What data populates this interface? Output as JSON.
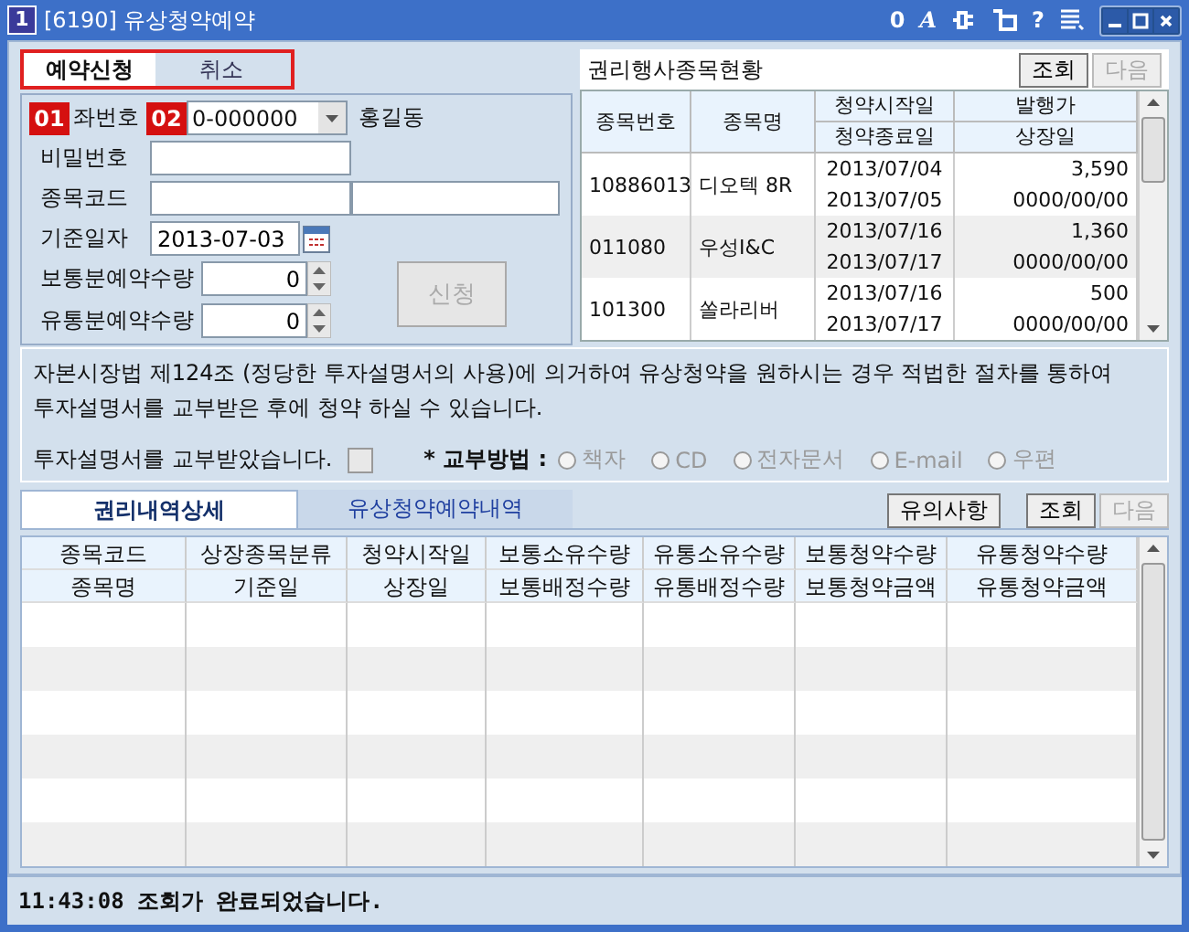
{
  "window": {
    "icon": "1",
    "title": "[6190] 유상청약예약",
    "toolbar": [
      {
        "kind": "text",
        "label": "0"
      },
      {
        "kind": "italic",
        "label": "A"
      },
      {
        "kind": "plug"
      },
      {
        "kind": "corner"
      },
      {
        "kind": "text",
        "label": "?"
      },
      {
        "kind": "list"
      }
    ]
  },
  "markers": [
    {
      "label": "01"
    },
    {
      "label": "02"
    }
  ],
  "top_tabs": [
    {
      "label": "예약신청",
      "selected": true
    },
    {
      "label": "취소",
      "selected": false
    }
  ],
  "form": {
    "account": {
      "label": "좌번호",
      "value": "0-000000",
      "owner": "홍길동"
    },
    "password": {
      "label": "비밀번호"
    },
    "stock_code": {
      "label": "종목코드"
    },
    "base_date": {
      "label": "기준일자",
      "value": "2013-07-03"
    },
    "normal_qty": {
      "label": "보통분예약수량",
      "value": "0"
    },
    "circ_qty": {
      "label": "유통분예약수량",
      "value": "0"
    },
    "submit": {
      "label": "신청",
      "disabled": true
    }
  },
  "rights_panel": {
    "title": "권리행사종목현황",
    "buttons": [
      {
        "label": "조회",
        "disabled": false
      },
      {
        "label": "다음",
        "disabled": true
      }
    ],
    "columns": [
      {
        "label": "종목번호"
      },
      {
        "label": "종목명"
      },
      {
        "label": "청약시작일",
        "sublabel": "청약종료일"
      },
      {
        "label": "발행가",
        "sublabel": "상장일"
      }
    ],
    "rows": [
      {
        "code": "10886013",
        "name": "디오텍 8R",
        "start": "2013/07/04",
        "end": "2013/07/05",
        "price": "3,590",
        "listing": "0000/00/00"
      },
      {
        "code": "011080",
        "name": "우성I&C",
        "start": "2013/07/16",
        "end": "2013/07/17",
        "price": "1,360",
        "listing": "0000/00/00"
      },
      {
        "code": "101300",
        "name": "쏠라리버",
        "start": "2013/07/16",
        "end": "2013/07/17",
        "price": "500",
        "listing": "0000/00/00"
      }
    ]
  },
  "notice": {
    "lines": [
      "자본시장법 제124조 (정당한 투자설명서의 사용)에 의거하여 유상청약을 원하시는 경우 적법한 절차를 통하여",
      "투자설명서를 교부받은 후에 청약 하실 수 있습니다."
    ],
    "confirm": {
      "label": "투자설명서를 교부받았습니다.",
      "checked": false
    },
    "delivery": {
      "label": "* 교부방법 :",
      "options": [
        {
          "label": "책자",
          "selected": false,
          "disabled": true
        },
        {
          "label": "CD",
          "selected": false,
          "disabled": true
        },
        {
          "label": "전자문서",
          "selected": false,
          "disabled": true
        },
        {
          "label": "E-mail",
          "selected": false,
          "disabled": true
        },
        {
          "label": "우편",
          "selected": false,
          "disabled": true
        }
      ]
    }
  },
  "bottom_tabs": [
    {
      "label": "권리내역상세",
      "selected": true
    },
    {
      "label": "유상청약예약내역",
      "selected": false
    }
  ],
  "bottom_buttons": [
    {
      "label": "유의사항",
      "disabled": false
    },
    {
      "label": "조회",
      "disabled": false
    },
    {
      "label": "다음",
      "disabled": true
    }
  ],
  "grid": {
    "header_top": [
      "종목코드",
      "상장종목분류",
      "청약시작일",
      "보통소유수량",
      "유통소유수량",
      "보통청약수량",
      "유통청약수량"
    ],
    "header_bottom": [
      "종목명",
      "기준일",
      "상장일",
      "보통배정수량",
      "유통배정수량",
      "보통청약금액",
      "유통청약금액"
    ]
  },
  "status_bar": "11:43:08 조회가 완료되었습니다."
}
